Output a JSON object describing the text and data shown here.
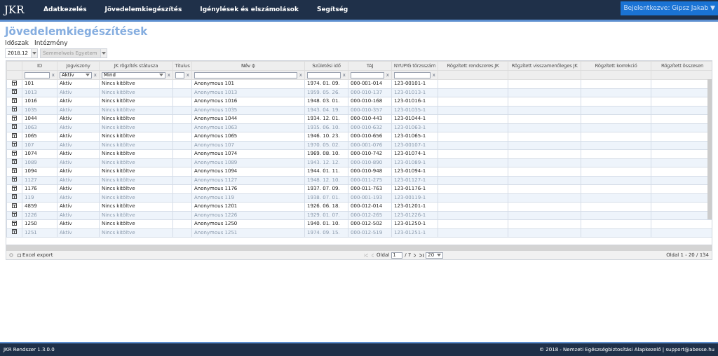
{
  "navbar": {
    "logo": "JKR",
    "items": [
      "Adatkezelés",
      "Jövedelemkiegészítés",
      "Igénylések és elszámolások",
      "Segítség"
    ],
    "user_menu": "Bejelentkezve: Gipsz Jakab ▼"
  },
  "page_title": "Jövedelemkiegészítések",
  "filters": {
    "labels": [
      "Időszak",
      "Intézmény"
    ],
    "period": {
      "value": "2018.12",
      "disabled": false
    },
    "institution": {
      "value": "Semmelweis Egyetem",
      "disabled": true
    }
  },
  "table": {
    "columns": [
      {
        "label": "ID",
        "sorted": false,
        "filter": {
          "kind": "text",
          "clear": "x"
        }
      },
      {
        "label": "Jogviszony",
        "sorted": false,
        "filter": {
          "kind": "select",
          "value": "Aktív",
          "clear": "x"
        }
      },
      {
        "label": "JK rögzítés státusza",
        "sorted": false,
        "filter": {
          "kind": "select",
          "value": "Mind",
          "clear": "x"
        }
      },
      {
        "label": "Titulus",
        "sorted": false,
        "filter": {
          "kind": "text",
          "clear": "x"
        }
      },
      {
        "label": "Név",
        "sorted": true,
        "filter": {
          "kind": "text",
          "clear": "x"
        }
      },
      {
        "label": "Születési idő",
        "sorted": false,
        "filter": {
          "kind": "text",
          "clear": "x"
        }
      },
      {
        "label": "TAJ",
        "sorted": false,
        "filter": {
          "kind": "text",
          "clear": "x"
        }
      },
      {
        "label": "NYUPIG törzsszám",
        "sorted": false,
        "filter": {
          "kind": "text",
          "clear": "x"
        }
      },
      {
        "label": "Rögzített rendszeres JK",
        "sorted": false
      },
      {
        "label": "Rögzített visszamenőleges JK",
        "sorted": false
      },
      {
        "label": "Rögzített korrekció",
        "sorted": false
      },
      {
        "label": "Rögzített összesen",
        "sorted": false
      }
    ],
    "rows": [
      [
        "101",
        "Aktív",
        "Nincs kitöltve",
        "",
        "Anonymous 101",
        "1974. 01. 09.",
        "000-001-014",
        "123-00101-1"
      ],
      [
        "1013",
        "Aktív",
        "Nincs kitöltve",
        "",
        "Anonymous 1013",
        "1959. 05. 26.",
        "000-010-137",
        "123-01013-1"
      ],
      [
        "1016",
        "Aktív",
        "Nincs kitöltve",
        "",
        "Anonymous 1016",
        "1948. 03. 01.",
        "000-010-168",
        "123-01016-1"
      ],
      [
        "1035",
        "Aktív",
        "Nincs kitöltve",
        "",
        "Anonymous 1035",
        "1943. 04. 19.",
        "000-010-357",
        "123-01035-1"
      ],
      [
        "1044",
        "Aktív",
        "Nincs kitöltve",
        "",
        "Anonymous 1044",
        "1934. 12. 01.",
        "000-010-443",
        "123-01044-1"
      ],
      [
        "1063",
        "Aktív",
        "Nincs kitöltve",
        "",
        "Anonymous 1063",
        "1935. 06. 10.",
        "000-010-632",
        "123-01063-1"
      ],
      [
        "1065",
        "Aktív",
        "Nincs kitöltve",
        "",
        "Anonymous 1065",
        "1946. 10. 23.",
        "000-010-656",
        "123-01065-1"
      ],
      [
        "107",
        "Aktív",
        "Nincs kitöltve",
        "",
        "Anonymous 107",
        "1970. 05. 02.",
        "000-001-076",
        "123-00107-1"
      ],
      [
        "1074",
        "Aktív",
        "Nincs kitöltve",
        "",
        "Anonymous 1074",
        "1969. 08. 10.",
        "000-010-742",
        "123-01074-1"
      ],
      [
        "1089",
        "Aktív",
        "Nincs kitöltve",
        "",
        "Anonymous 1089",
        "1943. 12. 12.",
        "000-010-890",
        "123-01089-1"
      ],
      [
        "1094",
        "Aktív",
        "Nincs kitöltve",
        "",
        "Anonymous 1094",
        "1944. 01. 11.",
        "000-010-948",
        "123-01094-1"
      ],
      [
        "1127",
        "Aktív",
        "Nincs kitöltve",
        "",
        "Anonymous 1127",
        "1948. 12. 10.",
        "000-011-275",
        "123-01127-1"
      ],
      [
        "1176",
        "Aktív",
        "Nincs kitöltve",
        "",
        "Anonymous 1176",
        "1937. 07. 09.",
        "000-011-763",
        "123-01176-1"
      ],
      [
        "119",
        "Aktív",
        "Nincs kitöltve",
        "",
        "Anonymous 119",
        "1938. 07. 01.",
        "000-001-193",
        "123-00119-1"
      ],
      [
        "4859",
        "Aktív",
        "Nincs kitöltve",
        "",
        "Anonymous 1201",
        "1926. 06. 18.",
        "000-012-014",
        "123-01201-1"
      ],
      [
        "1226",
        "Aktív",
        "Nincs kitöltve",
        "",
        "Anonymous 1226",
        "1929. 01. 07.",
        "000-012-265",
        "123-01226-1"
      ],
      [
        "1250",
        "Aktív",
        "Nincs kitöltve",
        "",
        "Anonymous 1250",
        "1940. 01. 10.",
        "000-012-502",
        "123-01250-1"
      ],
      [
        "1251",
        "Aktív",
        "Nincs kitöltve",
        "",
        "Anonymous 1251",
        "1974. 09. 15.",
        "000-012-519",
        "123-01251-1"
      ]
    ]
  },
  "pager": {
    "export": "Excel export",
    "page_label": "Oldal",
    "page": "1",
    "total_pages": "/ 7",
    "page_size": "20",
    "summary": "Oldal 1 - 20 / 134"
  },
  "footer": {
    "version": "JKR Rendszer 1.3.0.0",
    "copyright": "© 2018 - Nemzeti Egészségbiztosítási Alapkezelő | support@abesse.hu"
  }
}
